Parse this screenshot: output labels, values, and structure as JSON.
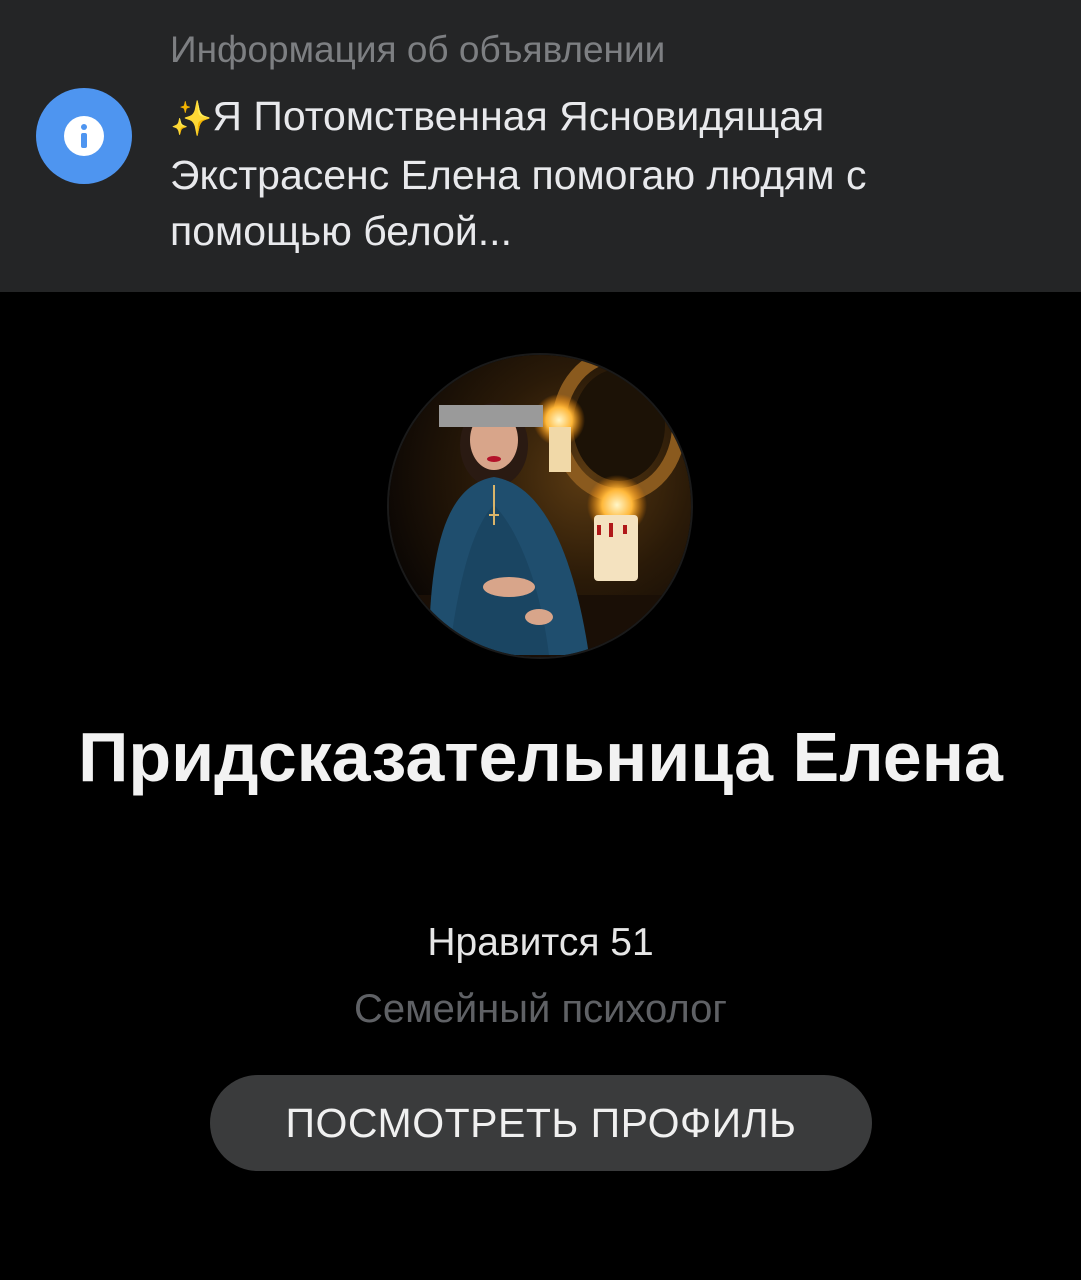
{
  "ad_info": {
    "heading": "Информация об объявлении",
    "icon": "info-icon",
    "sparkles": "✨",
    "text": "Я Потомственная Ясновидящая Экстрасенс Елена помогаю людям с помощью белой...",
    "accent_color": "#4e95f0"
  },
  "profile": {
    "avatar_icon": "profile-photo",
    "name": "Придсказательница Елена",
    "likes": "Нравится 51",
    "category": "Семейный психолог",
    "button_label": "ПОСМОТРЕТЬ ПРОФИЛЬ"
  }
}
